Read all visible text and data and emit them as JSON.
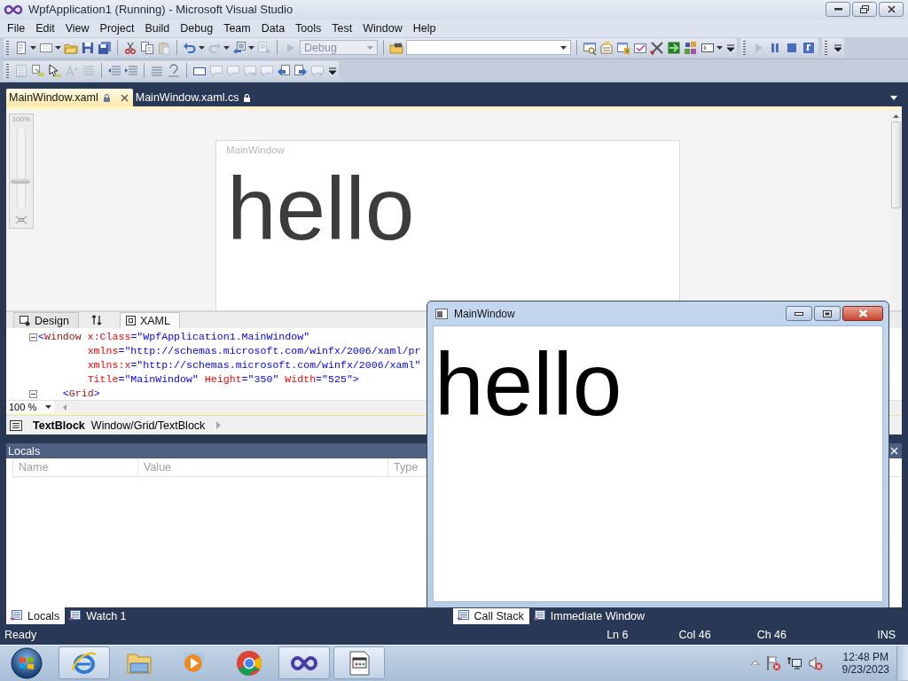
{
  "window": {
    "title": "WpfApplication1 (Running) - Microsoft Visual Studio"
  },
  "menu": [
    "File",
    "Edit",
    "View",
    "Project",
    "Build",
    "Debug",
    "Team",
    "Data",
    "Tools",
    "Test",
    "Window",
    "Help"
  ],
  "toolbar": {
    "configuration": {
      "value": "Debug",
      "disabled": true
    }
  },
  "document_tabs": [
    {
      "label": "MainWindow.xaml",
      "selected": true,
      "locked": true
    },
    {
      "label": "MainWindow.xaml.cs",
      "selected": false,
      "locked": true
    }
  ],
  "designer": {
    "zoom_label": "100%",
    "zoom_slider": {
      "level": 0.35
    },
    "window_title": "MainWindow",
    "text": "hello"
  },
  "view_tabs": [
    {
      "label": "Design",
      "selected": false
    },
    {
      "label": "XAML",
      "selected": true
    }
  ],
  "xaml_lines": [
    {
      "foldable": true,
      "tokens": [
        {
          "text": "<",
          "kind": "punct"
        },
        {
          "text": "Window",
          "kind": "tag"
        },
        {
          "text": " x:Class",
          "kind": "attr"
        },
        {
          "text": "=\"WpfApplication1.MainWindow\"",
          "kind": "value"
        }
      ]
    },
    {
      "foldable": false,
      "tokens": [
        {
          "text": "        xmlns",
          "kind": "attr"
        },
        {
          "text": "=\"http://schemas.microsoft.com/winfx/2006/xaml/pr",
          "kind": "value"
        }
      ]
    },
    {
      "foldable": false,
      "tokens": [
        {
          "text": "        xmlns:x",
          "kind": "attr"
        },
        {
          "text": "=\"http://schemas.microsoft.com/winfx/2006/xaml\"",
          "kind": "value"
        }
      ]
    },
    {
      "foldable": false,
      "tokens": [
        {
          "text": "        Title",
          "kind": "attr"
        },
        {
          "text": "=\"MainWindow\"",
          "kind": "value"
        },
        {
          "text": " Height",
          "kind": "attr"
        },
        {
          "text": "=\"350\"",
          "kind": "value"
        },
        {
          "text": " Width",
          "kind": "attr"
        },
        {
          "text": "=\"525\">",
          "kind": "value"
        }
      ]
    },
    {
      "foldable": true,
      "tokens": [
        {
          "text": "    <",
          "kind": "punct"
        },
        {
          "text": "Grid",
          "kind": "tag"
        },
        {
          "text": ">",
          "kind": "punct"
        }
      ]
    }
  ],
  "editor_zoom": "100 %",
  "breadcrumb": {
    "element": "TextBlock",
    "path": "Window/Grid/TextBlock"
  },
  "locals": {
    "title": "Locals",
    "columns": [
      "Name",
      "Value",
      "Type"
    ]
  },
  "bottom_tabs_left": [
    {
      "label": "Locals",
      "selected": true
    },
    {
      "label": "Watch 1",
      "selected": false
    }
  ],
  "bottom_tabs_right": [
    {
      "label": "Call Stack",
      "selected": true
    },
    {
      "label": "Immediate Window",
      "selected": false
    }
  ],
  "status_bar": {
    "message": "Ready",
    "line": "Ln 6",
    "column": "Col 46",
    "char": "Ch 46",
    "mode": "INS"
  },
  "running_window": {
    "title": "MainWindow",
    "text": "hello"
  },
  "taskbar": {
    "apps": [
      {
        "kind": "ie",
        "running": true
      },
      {
        "kind": "explorer",
        "running": false
      },
      {
        "kind": "media",
        "running": false
      },
      {
        "kind": "chrome",
        "running": false
      },
      {
        "kind": "vs",
        "running": true
      },
      {
        "kind": "app",
        "running": true
      }
    ],
    "time": "12:48 PM",
    "date": "9/23/2023"
  }
}
